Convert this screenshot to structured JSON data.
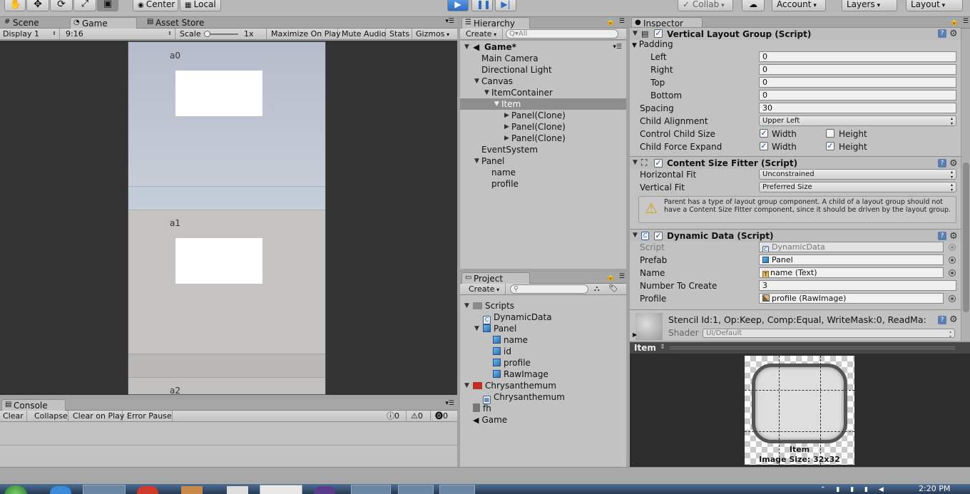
{
  "toolbar": {
    "hand_icon": "hand-tool-icon",
    "move_icon": "move-tool-icon",
    "rotate_icon": "rotate-tool-icon",
    "scale_icon": "scale-tool-icon",
    "rect_icon": "rect-tool-icon",
    "center_label": "Center",
    "local_label": "Local",
    "collab_label": "Collab",
    "account_label": "Account",
    "layers_label": "Layers",
    "layout_label": "Layout"
  },
  "scene_tabs": {
    "scene": "Scene",
    "game": "Game",
    "asset_store": "Asset Store"
  },
  "game_toolbar": {
    "display": "Display 1",
    "aspect": "9:16",
    "scale_label": "Scale",
    "scale_value": "1x",
    "maximize": "Maximize On Play",
    "mute": "Mute Audio",
    "stats": "Stats",
    "gizmos": "Gizmos"
  },
  "game_view": {
    "items": [
      {
        "label": "a0"
      },
      {
        "label": "a1"
      },
      {
        "label": "a2"
      }
    ]
  },
  "hierarchy": {
    "tab": "Hierarchy",
    "create": "Create",
    "search_placeholder": "Q▾All",
    "scene_name": "Game*",
    "rows": [
      {
        "label": "Main Camera"
      },
      {
        "label": "Directional Light"
      },
      {
        "label": "Canvas"
      },
      {
        "label": "ItemContainer"
      },
      {
        "label": "Item"
      },
      {
        "label": "Panel(Clone)"
      },
      {
        "label": "Panel(Clone)"
      },
      {
        "label": "Panel(Clone)"
      },
      {
        "label": "EventSystem"
      },
      {
        "label": "Panel"
      },
      {
        "label": "name"
      },
      {
        "label": "profile"
      }
    ]
  },
  "project": {
    "tab": "Project",
    "create": "Create",
    "rows": [
      {
        "label": "Scripts"
      },
      {
        "label": "DynamicData"
      },
      {
        "label": "Panel"
      },
      {
        "label": "name"
      },
      {
        "label": "id"
      },
      {
        "label": "profile"
      },
      {
        "label": "RawImage"
      },
      {
        "label": "Chrysanthemum"
      },
      {
        "label": "Chrysanthemum"
      },
      {
        "label": "fh"
      },
      {
        "label": "Game"
      }
    ]
  },
  "console": {
    "tab": "Console",
    "clear": "Clear",
    "collapse": "Collapse",
    "clear_on_play": "Clear on Play",
    "error_pause": "Error Pause",
    "log_count": "0",
    "warn_count": "0",
    "error_count": "0"
  },
  "inspector": {
    "tab": "Inspector",
    "vlg": {
      "title": "Vertical Layout Group (Script)",
      "padding": "Padding",
      "left_label": "Left",
      "left_value": "0",
      "right_label": "Right",
      "right_value": "0",
      "top_label": "Top",
      "top_value": "0",
      "bottom_label": "Bottom",
      "bottom_value": "0",
      "spacing_label": "Spacing",
      "spacing_value": "30",
      "child_alignment_label": "Child Alignment",
      "child_alignment_value": "Upper Left",
      "control_child_size_label": "Control Child Size",
      "force_expand_label": "Child Force Expand",
      "width": "Width",
      "height": "Height"
    },
    "csf": {
      "title": "Content Size Fitter (Script)",
      "hfit_label": "Horizontal Fit",
      "hfit_value": "Unconstrained",
      "vfit_label": "Vertical Fit",
      "vfit_value": "Preferred Size",
      "warning": "Parent has a type of layout group component. A child of a layout group should not have a Content Size Fitter component, since it should be driven by the layout group."
    },
    "dyn": {
      "title": "Dynamic Data (Script)",
      "script_label": "Script",
      "script_value": "DynamicData",
      "prefab_label": "Prefab",
      "prefab_value": "Panel",
      "name_label": "Name",
      "name_value": "name (Text)",
      "number_label": "Number To Create",
      "number_value": "3",
      "profile_label": "Profile",
      "profile_value": "profile (RawImage)"
    },
    "material": {
      "name": "Stencil Id:1, Op:Keep, Comp:Equal, WriteMask:0, ReadMa:",
      "shader_label": "Shader",
      "shader_value": "UI/Default"
    },
    "preview": {
      "header": "Item",
      "caption_name": "Item",
      "caption_size": "Image Size: 32x32"
    }
  },
  "taskbar": {
    "time": "2:20 PM"
  }
}
